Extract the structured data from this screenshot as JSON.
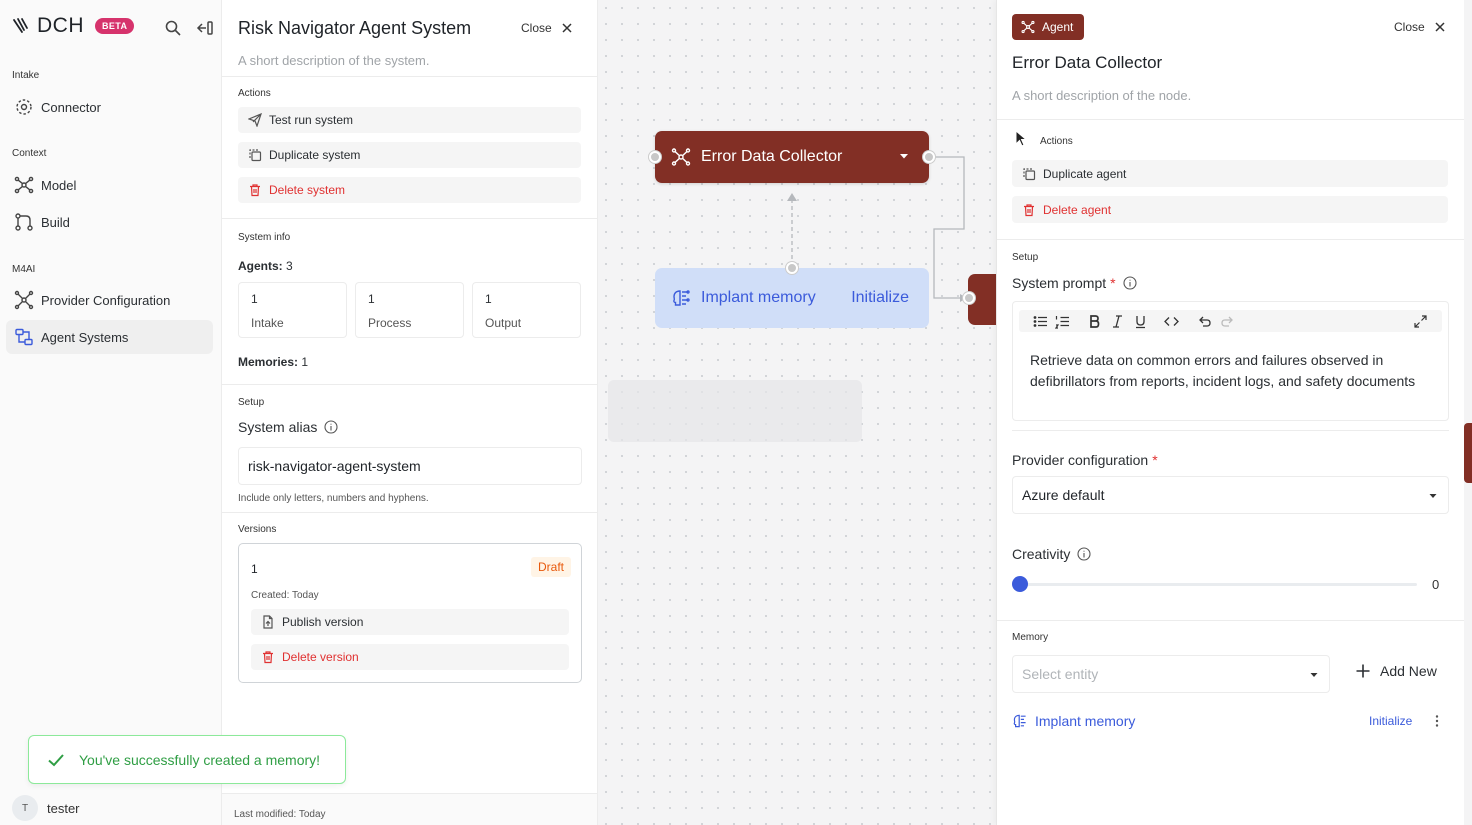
{
  "sidebar": {
    "brand": "DCH",
    "beta": "BETA",
    "sections": {
      "intake": "Intake",
      "context": "Context",
      "m4ai": "M4AI"
    },
    "items": {
      "connector": "Connector",
      "model": "Model",
      "build": "Build",
      "provider": "Provider Configuration",
      "agent_systems": "Agent Systems"
    },
    "user": {
      "initial": "T",
      "name": "tester"
    }
  },
  "toast": {
    "message": "You've successfully created a memory!"
  },
  "system_panel": {
    "title": "Risk Navigator Agent System",
    "close": "Close",
    "description": "A short description of the system.",
    "actions_label": "Actions",
    "actions": {
      "test_run": "Test run system",
      "duplicate": "Duplicate system",
      "delete": "Delete system"
    },
    "system_info_label": "System info",
    "agents_label": "Agents:",
    "agents_count": "3",
    "stats": [
      {
        "count": "1",
        "label": "Intake"
      },
      {
        "count": "1",
        "label": "Process"
      },
      {
        "count": "1",
        "label": "Output"
      }
    ],
    "memories_label": "Memories:",
    "memories_count": "1",
    "setup_label": "Setup",
    "alias_label": "System alias",
    "alias_value": "risk-navigator-agent-system",
    "alias_hint": "Include only letters, numbers and hyphens.",
    "versions_label": "Versions",
    "version": {
      "number": "1",
      "status": "Draft",
      "created": "Created: Today",
      "publish": "Publish version",
      "delete": "Delete version"
    },
    "last_modified": "Last modified: Today"
  },
  "canvas": {
    "agent_node": {
      "label": "Error Data Collector"
    },
    "memory_node": {
      "label": "Implant memory",
      "action": "Initialize"
    }
  },
  "node_panel": {
    "badge": "Agent",
    "close": "Close",
    "title": "Error Data Collector",
    "description": "A short description of the node.",
    "actions_label": "Actions",
    "actions": {
      "duplicate": "Duplicate agent",
      "delete": "Delete agent"
    },
    "setup_label": "Setup",
    "system_prompt_label": "System prompt",
    "required_mark": "*",
    "system_prompt": "Retrieve data on common errors and failures observed in defibrillators from reports, incident logs, and safety documents",
    "provider_label": "Provider configuration",
    "provider_value": "Azure default",
    "creativity_label": "Creativity",
    "creativity_value": "0",
    "creativity_fraction": 0,
    "memory_label": "Memory",
    "memory_placeholder": "Select entity",
    "add_new": "Add New",
    "memory_item": {
      "label": "Implant memory",
      "action": "Initialize"
    }
  },
  "colors": {
    "agent": "#822f25",
    "memory_bg": "#d0def8",
    "accent": "#3b5bdb",
    "danger": "#e03131",
    "success": "#2f9e44",
    "beta": "#d6336c"
  }
}
